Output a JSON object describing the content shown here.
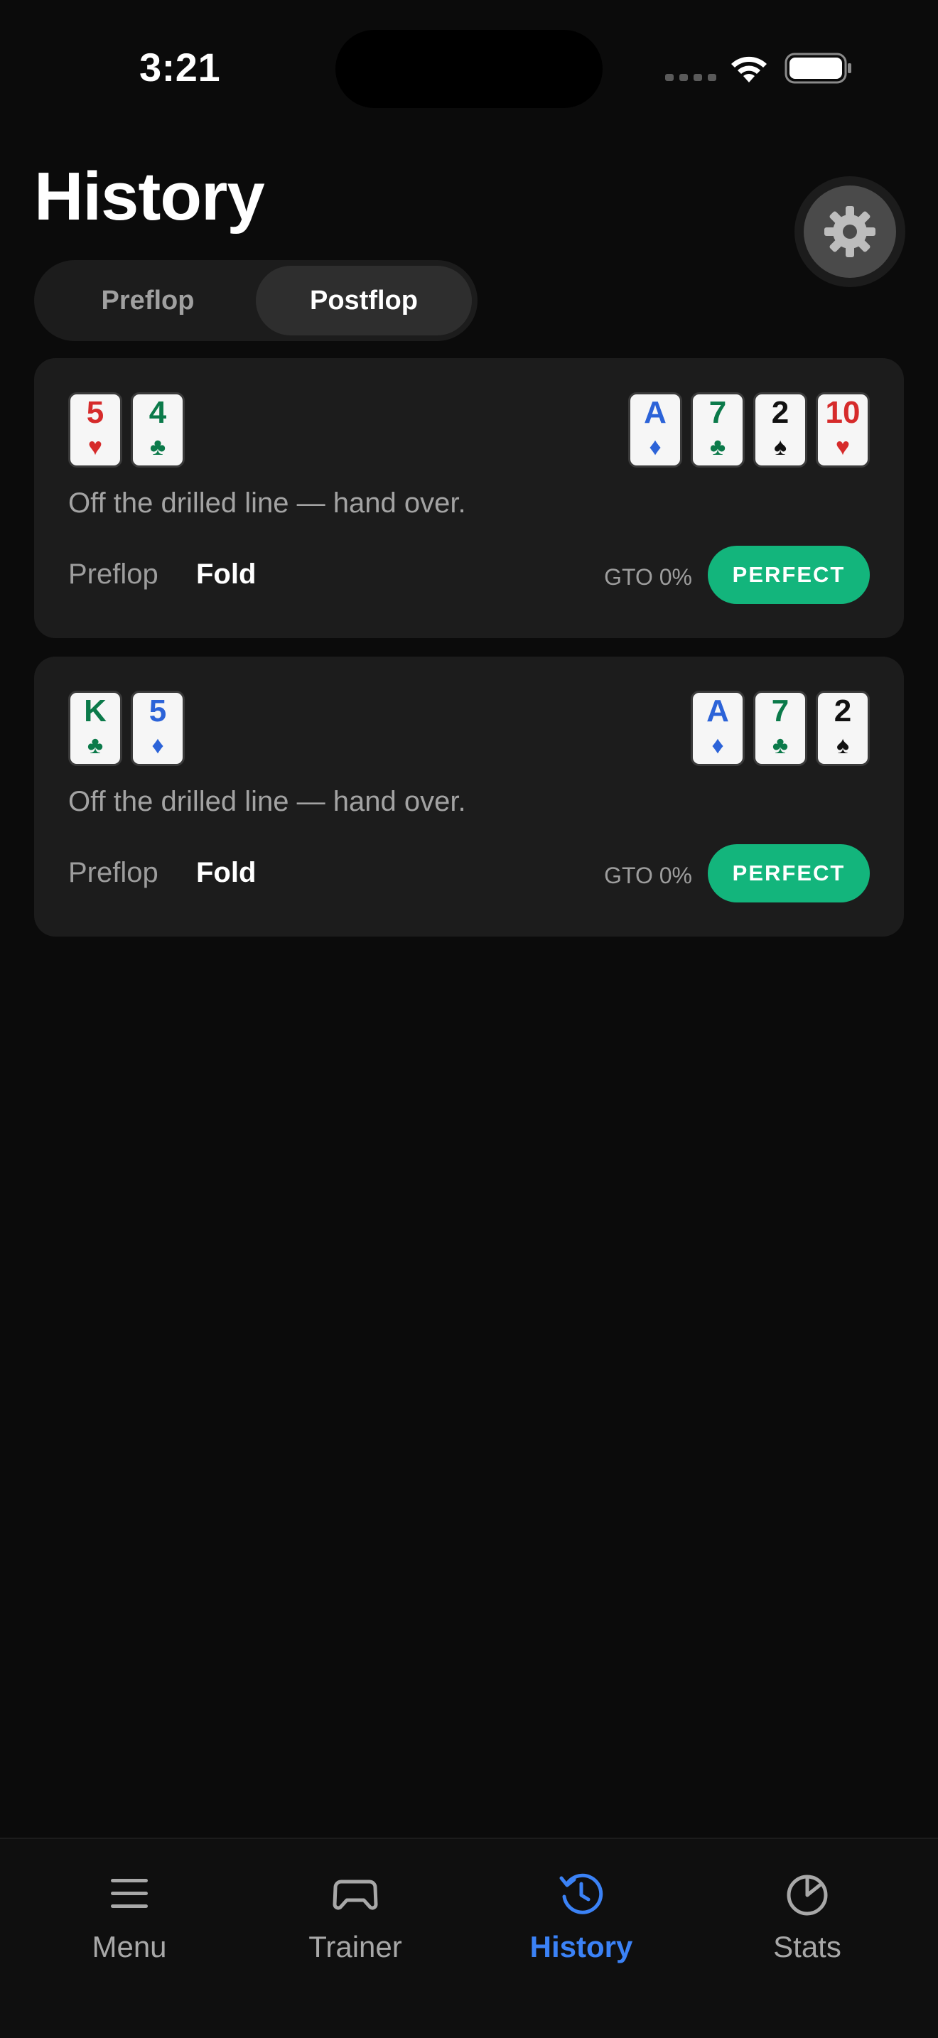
{
  "status_bar": {
    "time": "3:21"
  },
  "header": {
    "title": "History"
  },
  "segmented": {
    "options": [
      "Preflop",
      "Postflop"
    ],
    "selected": "Postflop"
  },
  "hands": [
    {
      "hole_cards": [
        {
          "rank": "5",
          "suit": "♥",
          "color": "#d62b2b"
        },
        {
          "rank": "4",
          "suit": "♣",
          "color": "#0b7a4a"
        }
      ],
      "board": [
        {
          "rank": "A",
          "suit": "♦",
          "color": "#2c63d8"
        },
        {
          "rank": "7",
          "suit": "♣",
          "color": "#0b7a4a"
        },
        {
          "rank": "2",
          "suit": "♠",
          "color": "#111111"
        },
        {
          "rank": "10",
          "suit": "♥",
          "color": "#d62b2b"
        }
      ],
      "description": "Off the drilled line — hand over.",
      "street": "Preflop",
      "action": "Fold",
      "gto": "GTO 0%",
      "grade": "PERFECT"
    },
    {
      "hole_cards": [
        {
          "rank": "K",
          "suit": "♣",
          "color": "#0b7a4a"
        },
        {
          "rank": "5",
          "suit": "♦",
          "color": "#2c63d8"
        }
      ],
      "board": [
        {
          "rank": "A",
          "suit": "♦",
          "color": "#2c63d8"
        },
        {
          "rank": "7",
          "suit": "♣",
          "color": "#0b7a4a"
        },
        {
          "rank": "2",
          "suit": "♠",
          "color": "#111111"
        }
      ],
      "description": "Off the drilled line — hand over.",
      "street": "Preflop",
      "action": "Fold",
      "gto": "GTO 0%",
      "grade": "PERFECT"
    }
  ],
  "tabbar": {
    "items": [
      {
        "label": "Menu",
        "icon": "menu-icon"
      },
      {
        "label": "Trainer",
        "icon": "gamepad-icon"
      },
      {
        "label": "History",
        "icon": "history-icon",
        "active": true
      },
      {
        "label": "Stats",
        "icon": "pie-chart-icon"
      }
    ]
  },
  "colors": {
    "accent": "#3b82f6",
    "perfect": "#13b57c",
    "background": "#0b0b0b",
    "card": "#1c1c1c"
  }
}
